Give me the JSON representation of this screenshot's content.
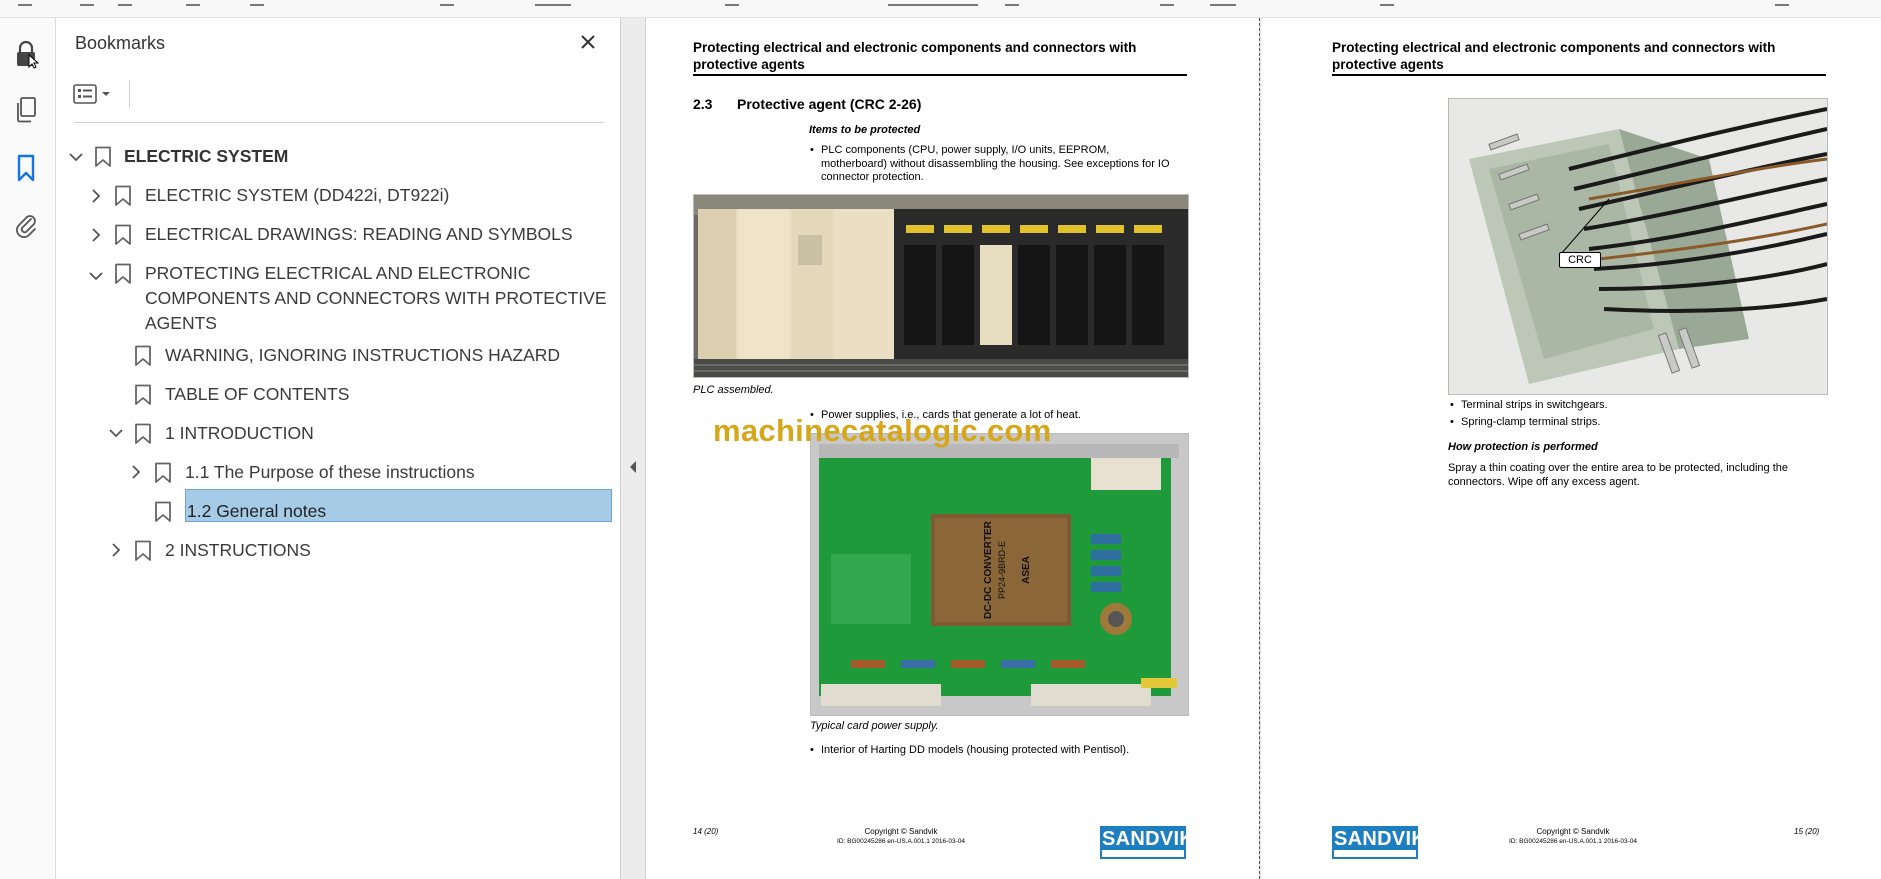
{
  "panel": {
    "title": "Bookmarks",
    "close_icon": "close-icon",
    "options_icon": "list-options-icon"
  },
  "rail": {
    "icons": [
      "lock-icon",
      "pages-icon",
      "bookmark-icon",
      "attachment-icon"
    ]
  },
  "bookmarks": [
    {
      "label": "ELECTRIC SYSTEM",
      "expanded": true
    },
    {
      "label": "ELECTRIC SYSTEM (DD422i, DT922i)",
      "expanded": false
    },
    {
      "label": "ELECTRICAL DRAWINGS: READING AND SYMBOLS",
      "expanded": false
    },
    {
      "label": "PROTECTING ELECTRICAL AND ELECTRONIC",
      "label2": "COMPONENTS AND CONNECTORS WITH PROTECTIVE",
      "label3": "AGENTS",
      "expanded": true
    },
    {
      "label": "WARNING, IGNORING INSTRUCTIONS HAZARD"
    },
    {
      "label": "TABLE OF CONTENTS"
    },
    {
      "label": "1 INTRODUCTION",
      "expanded": true
    },
    {
      "label": "1.1 The Purpose of these instructions",
      "expanded": false
    },
    {
      "label": "1.2 General notes",
      "selected": true
    },
    {
      "label": "2 INSTRUCTIONS",
      "expanded": false
    }
  ],
  "page_left": {
    "header_line1": "Protecting electrical and electronic components and connectors with",
    "header_line2": "protective agents",
    "section_num": "2.3",
    "section_title": "Protective agent (CRC 2-26)",
    "items_heading": "Items to be protected",
    "bullet1_l1": "PLC components (CPU, power supply, I/O units, EEPROM,",
    "bullet1_l2": "motherboard) without disassembling the housing. See exceptions for IO",
    "bullet1_l3": "connector protection.",
    "caption1": "PLC assembled.",
    "bullet2": "Power supplies, i.e., cards that generate a lot of heat.",
    "caption2": "Typical card power supply.",
    "bullet3": "Interior of Harting DD models (housing protected with Pentisol).",
    "page_no": "14 (20)",
    "copyright": "Copyright © Sandvik",
    "doc_id": "ID: BG00245286 en-US.A.001.1 2016-03-04",
    "logo": "SANDVIK"
  },
  "page_right": {
    "header_line1": "Protecting electrical and electronic components and connectors with",
    "header_line2": "protective agents",
    "crc_label": "CRC",
    "bullet1": "Terminal strips in switchgears.",
    "bullet2": "Spring-clamp terminal strips.",
    "how_heading": "How protection is performed",
    "body_l1": "Spray a thin coating over the entire area to be protected, including the",
    "body_l2": "connectors. Wipe off any excess agent.",
    "page_no": "15 (20)",
    "copyright": "Copyright © Sandvik",
    "doc_id": "ID: BG00245286 en-US.A.001.1 2016-03-04",
    "logo": "SANDVIK"
  },
  "watermark": "machinecatalogic.com",
  "pcb_labels": {
    "chip_brand": "ASEA",
    "chip_model": "DC-DC CONVERTER",
    "chip_part": "PP24-9BRD-E"
  }
}
